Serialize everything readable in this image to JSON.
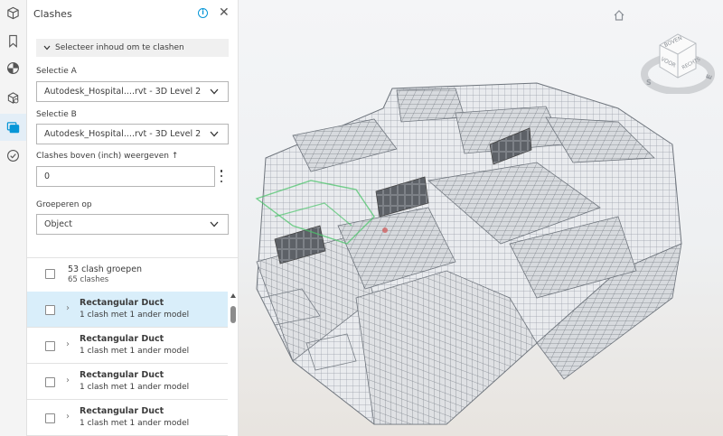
{
  "rail": {
    "icons": [
      "cube-icon",
      "bookmark-icon",
      "globe-icon",
      "model-browser-icon",
      "clashes-icon",
      "check-icon"
    ],
    "active": "clashes-icon"
  },
  "panel": {
    "title": "Clashes",
    "select_content_label": "Selecteer inhoud om te clashen",
    "selection_a": {
      "label": "Selectie A",
      "value": "Autodesk_Hospital....rvt - 3D Level 2"
    },
    "selection_b": {
      "label": "Selectie B",
      "value": "Autodesk_Hospital....rvt - 3D Level 2"
    },
    "threshold": {
      "label": "Clashes boven (inch) weergeven ↑",
      "value": "0"
    },
    "group_by": {
      "label": "Groeperen op",
      "value": "Object"
    },
    "summary": {
      "groups": "53 clash groepen",
      "clashes": "65 clashes"
    },
    "rows": [
      {
        "title": "Rectangular Duct",
        "subtitle": "1 clash met 1 ander model",
        "selected": true
      },
      {
        "title": "Rectangular Duct",
        "subtitle": "1 clash met 1 ander model",
        "selected": false
      },
      {
        "title": "Rectangular Duct",
        "subtitle": "1 clash met 1 ander model",
        "selected": false
      },
      {
        "title": "Rectangular Duct",
        "subtitle": "1 clash met 1 ander model",
        "selected": false
      }
    ]
  },
  "viewer": {
    "viewcube": {
      "top": "BOVEN",
      "front": "VOOR",
      "right": "RECHTS",
      "south": "S",
      "east": "E"
    }
  },
  "colors": {
    "accent": "#0696d7",
    "selected_row": "#d9eefa",
    "rail_bg": "#f4f4f4",
    "clash_green": "#4cc46b"
  }
}
